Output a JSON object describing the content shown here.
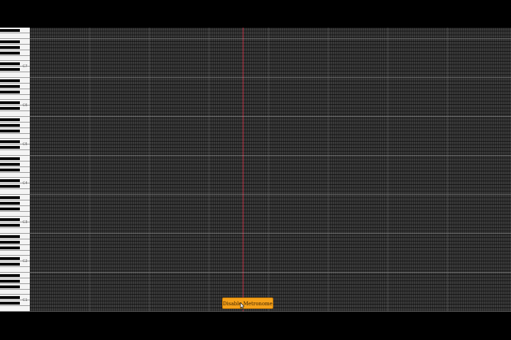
{
  "keyboard": {
    "octave_labels": [
      "C7",
      "C6",
      "C5",
      "C4",
      "C3",
      "C2",
      "C1"
    ]
  },
  "controls": {
    "metronome_label": "Disable Metronome"
  },
  "colors": {
    "background": "#000000",
    "grid": "#3a3a3a",
    "playhead": "#b3263a",
    "button": "#f5a11a"
  },
  "icons": {
    "cursor": "hand-pointer-icon"
  }
}
